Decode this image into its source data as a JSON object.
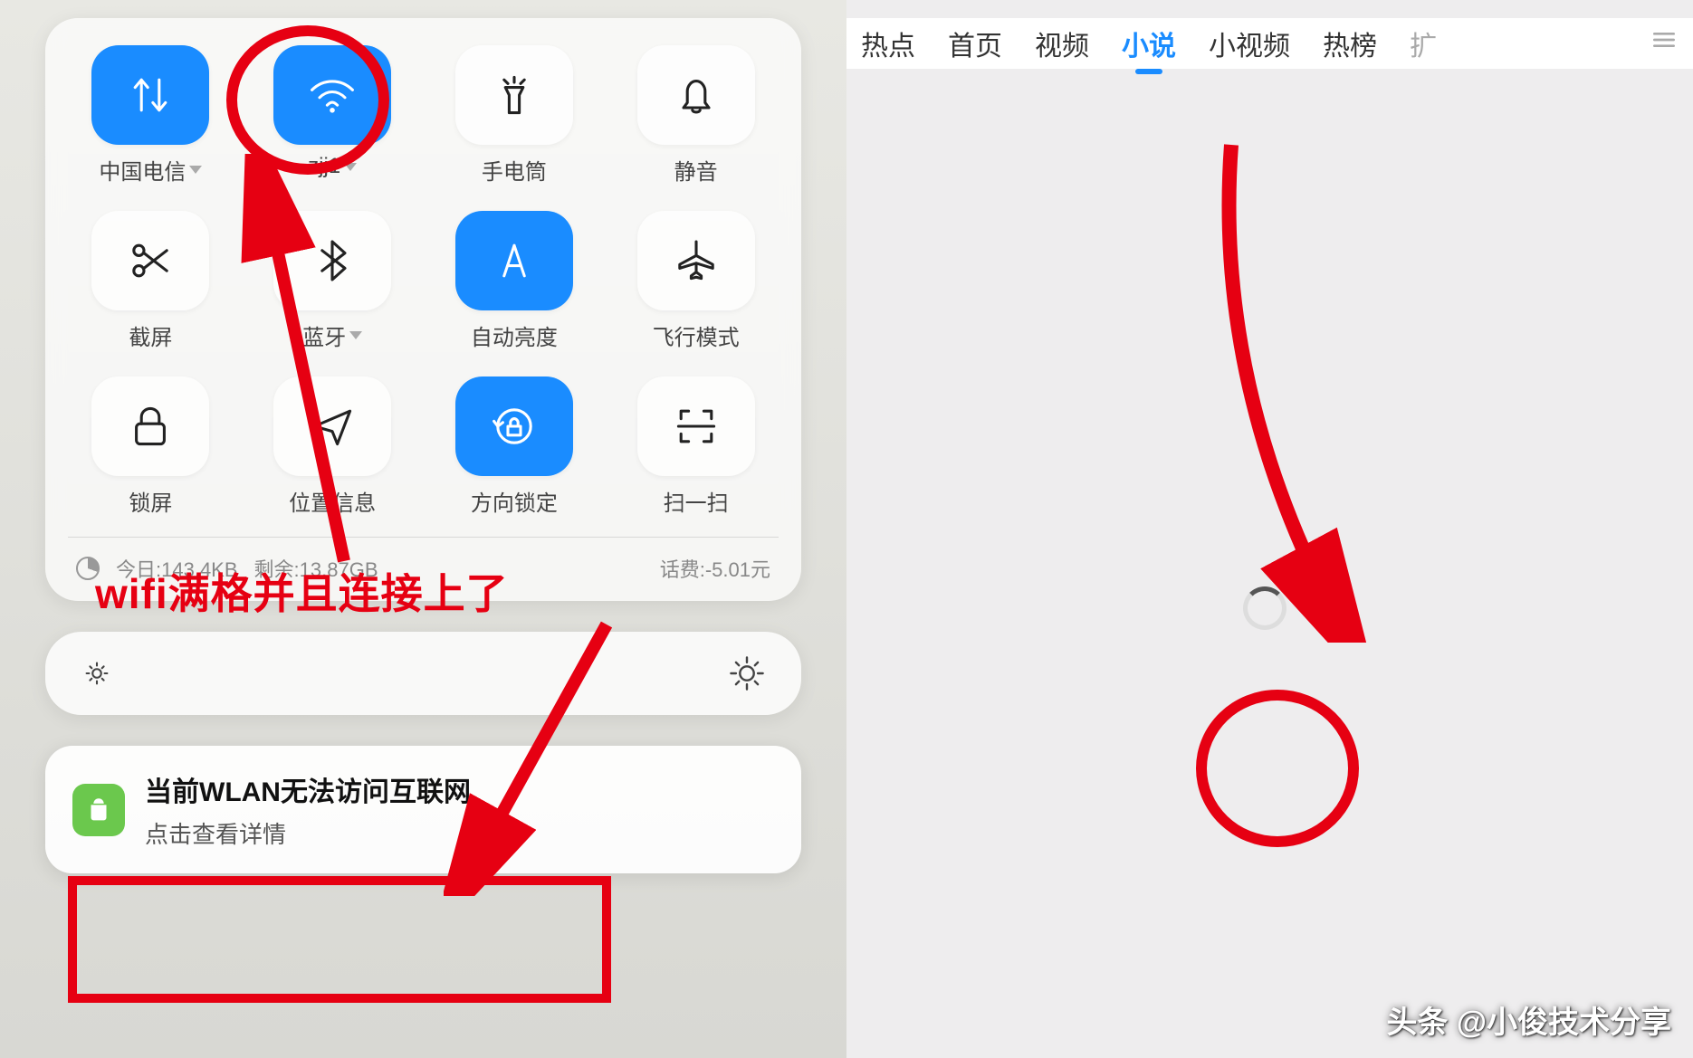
{
  "left": {
    "tiles": [
      {
        "id": "cellular",
        "label": "中国电信",
        "active": true,
        "caret": true
      },
      {
        "id": "wifi",
        "label": "zjj1",
        "active": true,
        "caret": true
      },
      {
        "id": "flashlight",
        "label": "手电筒",
        "active": false,
        "caret": false
      },
      {
        "id": "mute",
        "label": "静音",
        "active": false,
        "caret": false
      },
      {
        "id": "screenshot",
        "label": "截屏",
        "active": false,
        "caret": false
      },
      {
        "id": "bluetooth",
        "label": "蓝牙",
        "active": false,
        "caret": true
      },
      {
        "id": "autobrightness",
        "label": "自动亮度",
        "active": true,
        "caret": false
      },
      {
        "id": "airplane",
        "label": "飞行模式",
        "active": false,
        "caret": false
      },
      {
        "id": "lockscreen",
        "label": "锁屏",
        "active": false,
        "caret": false
      },
      {
        "id": "location",
        "label": "位置信息",
        "active": false,
        "caret": false
      },
      {
        "id": "orientation",
        "label": "方向锁定",
        "active": true,
        "caret": false
      },
      {
        "id": "scan",
        "label": "扫一扫",
        "active": false,
        "caret": false
      }
    ],
    "usage": {
      "today_label": "今日:",
      "today_value": "143.4KB",
      "remain_label": "剩余:",
      "remain_value": "13.87GB",
      "fee_label": "话费:",
      "fee_value": "-5.01元"
    },
    "notif": {
      "title": "当前WLAN无法访问互联网",
      "sub": "点击查看详情"
    },
    "anno_text": "wifi满格并且连接上了"
  },
  "right": {
    "tabs": [
      "热点",
      "首页",
      "视频",
      "小说",
      "小视频",
      "热榜",
      "扩"
    ],
    "active_tab": 3,
    "watermark": "头条 @小俊技术分享"
  }
}
